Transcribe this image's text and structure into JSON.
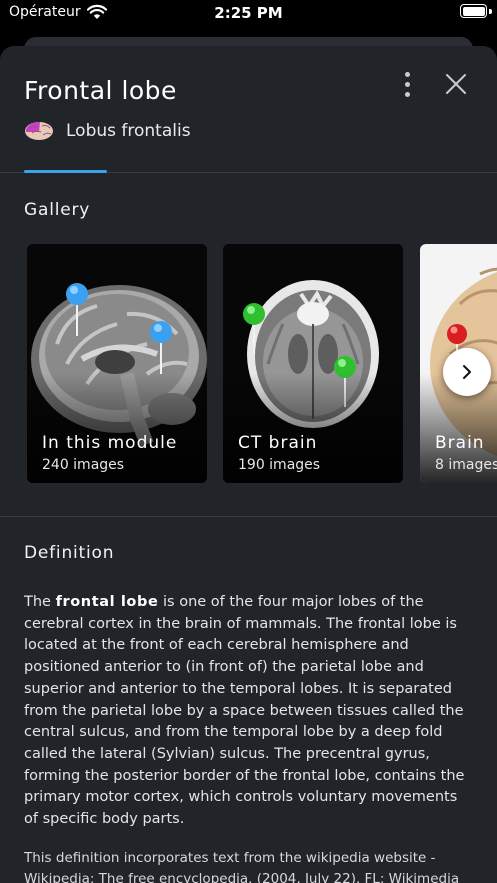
{
  "status_bar": {
    "carrier": "Opérateur",
    "time": "2:25 PM"
  },
  "header": {
    "title": "Frontal lobe",
    "subtitle": "Lobus frontalis"
  },
  "gallery": {
    "heading": "Gallery",
    "cards": [
      {
        "title": "In this module",
        "count": "240 images"
      },
      {
        "title": "CT brain",
        "count": "190 images"
      },
      {
        "title": "Brain",
        "count": "8 images"
      }
    ]
  },
  "definition": {
    "heading": "Definition",
    "lead": "The ",
    "term": "frontal lobe",
    "body": " is one of the four major lobes of the cerebral cortex in the brain of mammals. The frontal lobe is located at the front of each cerebral hemisphere and positioned anterior to (in front of) the parietal lobe and superior and anterior to the temporal lobes. It is separated from the parietal lobe by a space between tissues called the central sulcus, and from the temporal lobe by a deep fold called the lateral (Sylvian) sulcus. The precentral gyrus, forming the posterior border of the frontal lobe, contains the primary motor cortex, which controls voluntary movements of specific body parts.",
    "source": "This definition incorporates text from the wikipedia website - Wikipedia: The free encyclopedia. (2004, July 22). FL: Wikimedia"
  },
  "colors": {
    "sheet_background": "#212429",
    "tab_accent": "#3ea0e6",
    "pin_blue": "#3aa0f0",
    "pin_green": "#2fbf2f",
    "pin_red": "#d81e1e"
  },
  "icons": [
    "wifi-icon",
    "battery-icon",
    "more-vertical-icon",
    "close-icon",
    "brain-icon",
    "chevron-right-icon"
  ]
}
